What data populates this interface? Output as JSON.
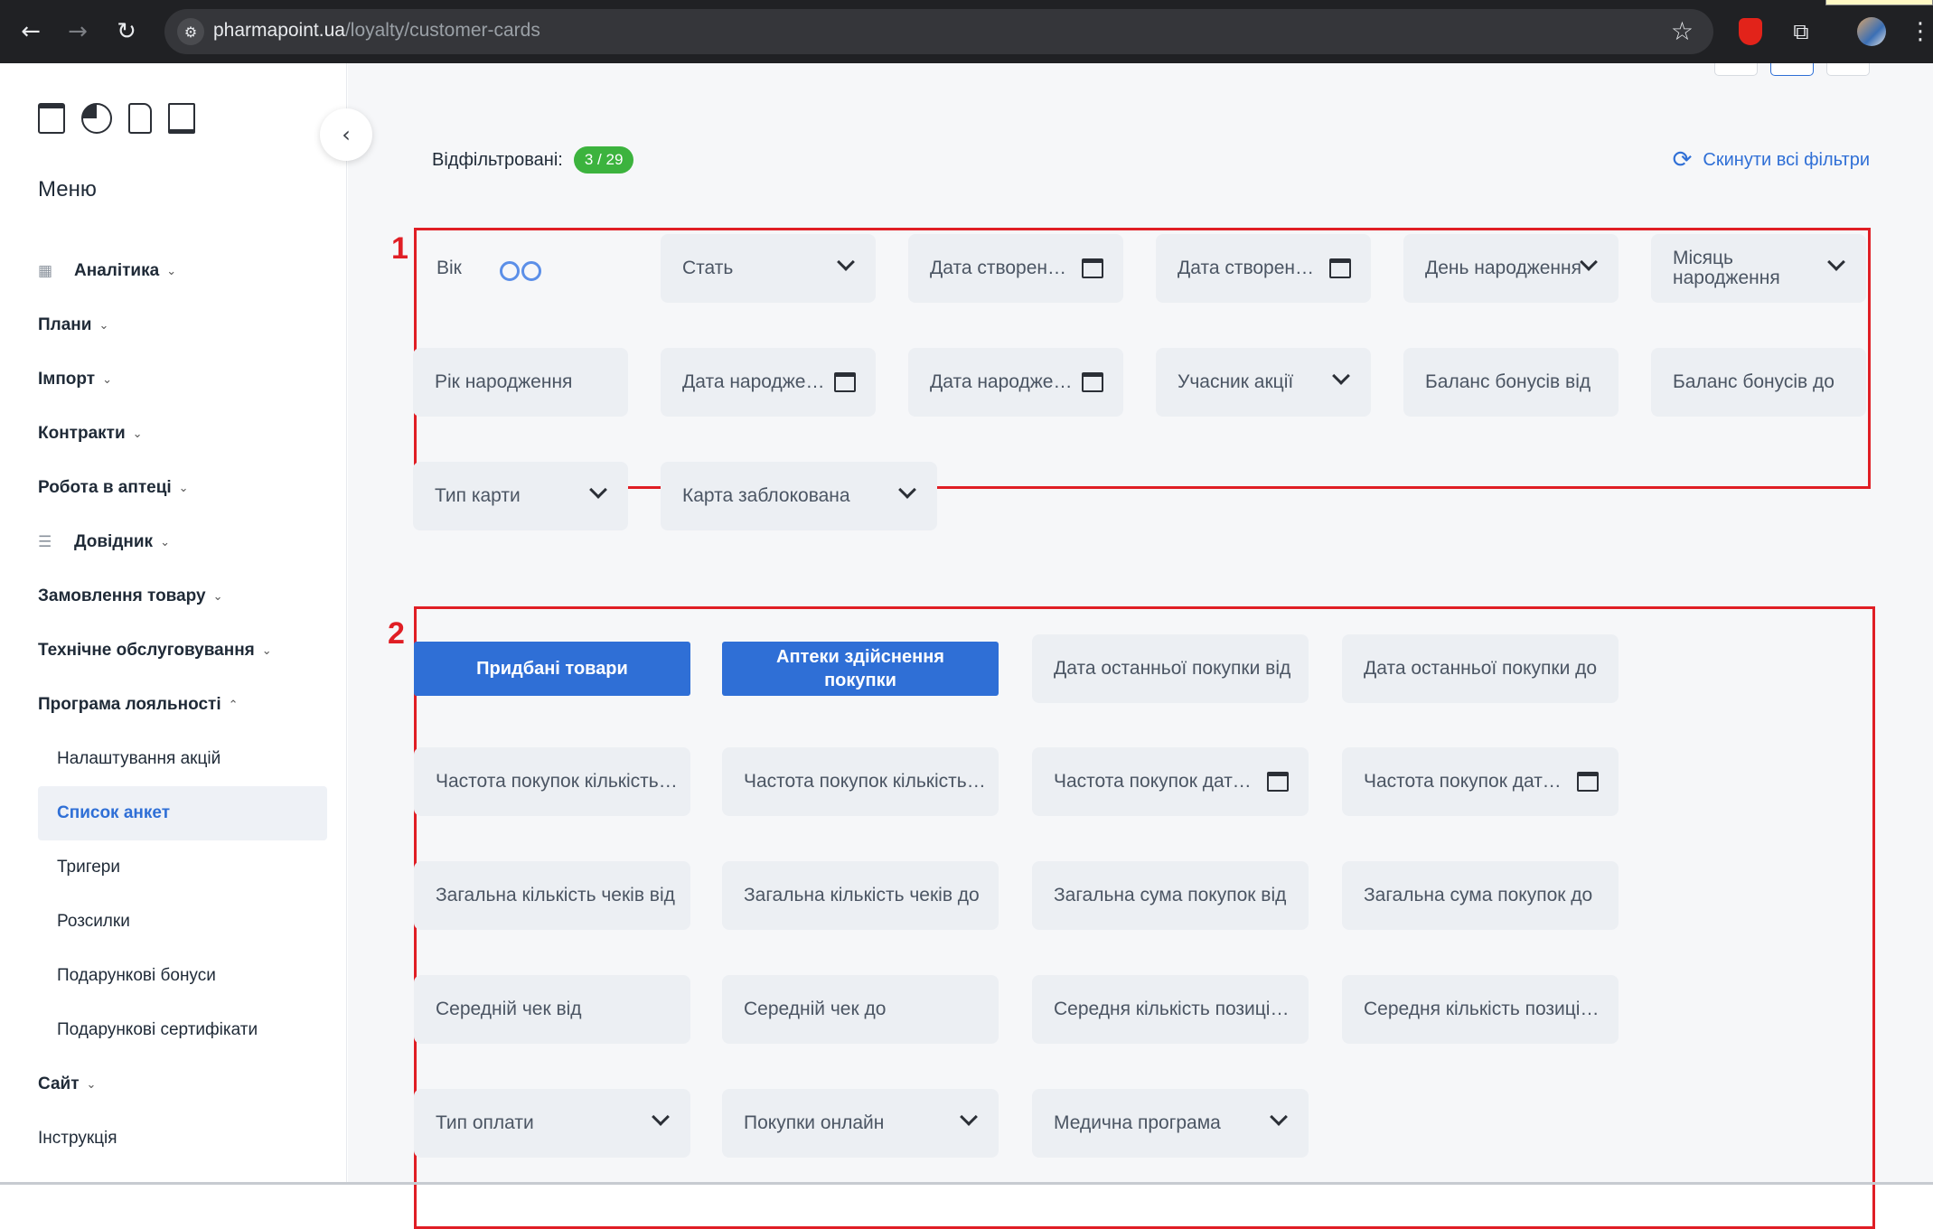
{
  "browser": {
    "url_domain": "pharmapoint.ua",
    "url_path": "/loyalty/customer-cards"
  },
  "sidebar": {
    "menu_title": "Меню",
    "items": [
      {
        "label": "Аналітика",
        "icon": "grid-icon",
        "expandable": true
      },
      {
        "label": "Плани",
        "expandable": true
      },
      {
        "label": "Імпорт",
        "expandable": true
      },
      {
        "label": "Контракти",
        "expandable": true
      },
      {
        "label": "Робота в аптеці",
        "expandable": true
      },
      {
        "label": "Довідник",
        "icon": "list-icon",
        "expandable": true
      },
      {
        "label": "Замовлення товару",
        "expandable": true
      },
      {
        "label": "Технічне обслуговування",
        "expandable": true
      },
      {
        "label": "Програма лояльності",
        "expandable": true,
        "expanded": true
      }
    ],
    "loyalty_subitems": [
      {
        "label": "Налаштування акцій"
      },
      {
        "label": "Список анкет",
        "active": true
      },
      {
        "label": "Тригери"
      },
      {
        "label": "Розсилки"
      },
      {
        "label": "Подарункові бонуси"
      },
      {
        "label": "Подарункові сертифікати"
      }
    ],
    "items_after": [
      {
        "label": "Сайт",
        "expandable": true
      },
      {
        "label": "Інструкція"
      }
    ]
  },
  "main": {
    "filtered_label": "Відфільтровані:",
    "filtered_count": "3 / 29",
    "reset_label": "Скинути всі фільтри",
    "section1_label": "1",
    "section2_label": "2",
    "section1": [
      {
        "label": "Вік",
        "control": "range-toggle"
      },
      {
        "label": "Стать",
        "control": "dropdown"
      },
      {
        "label": "Дата створення від",
        "control": "date"
      },
      {
        "label": "Дата створення до",
        "control": "date"
      },
      {
        "label": "День народження",
        "control": "dropdown"
      },
      {
        "label": "Місяць народження",
        "control": "dropdown"
      },
      {
        "label": "Рік народження",
        "control": "none"
      },
      {
        "label": "Дата народження від",
        "control": "date"
      },
      {
        "label": "Дата народження до",
        "control": "date"
      },
      {
        "label": "Учасник акції",
        "control": "dropdown"
      },
      {
        "label": "Баланс бонусів від",
        "control": "none"
      },
      {
        "label": "Баланс бонусів до",
        "control": "none"
      },
      {
        "label": "Тип карти",
        "control": "dropdown"
      },
      {
        "label": "Карта заблокована",
        "control": "dropdown"
      }
    ],
    "section2_buttons": [
      {
        "label": "Придбані товари"
      },
      {
        "label": "Аптеки здійснення покупки"
      }
    ],
    "section2": [
      {
        "label": "Дата останньої покупки від",
        "control": "none"
      },
      {
        "label": "Дата останньої покупки до",
        "control": "none"
      },
      {
        "label": "Частота покупок кількість від",
        "control": "none"
      },
      {
        "label": "Частота покупок кількість до",
        "control": "none"
      },
      {
        "label": "Частота покупок дата від",
        "control": "date"
      },
      {
        "label": "Частота покупок дата до",
        "control": "date"
      },
      {
        "label": "Загальна кількість чеків від",
        "control": "none"
      },
      {
        "label": "Загальна кількість чеків до",
        "control": "none"
      },
      {
        "label": "Загальна сума покупок від",
        "control": "none"
      },
      {
        "label": "Загальна сума покупок до",
        "control": "none"
      },
      {
        "label": "Середній чек від",
        "control": "none"
      },
      {
        "label": "Середній чек до",
        "control": "none"
      },
      {
        "label": "Середня кількість позицій від",
        "control": "none"
      },
      {
        "label": "Середня кількість позицій до",
        "control": "none"
      },
      {
        "label": "Тип оплати",
        "control": "dropdown"
      },
      {
        "label": "Покупки онлайн",
        "control": "dropdown"
      },
      {
        "label": "Медична програма",
        "control": "dropdown"
      }
    ]
  },
  "colors": {
    "accent": "#2f6fd6",
    "badge": "#3cb33e",
    "annotation": "#e01e25"
  }
}
